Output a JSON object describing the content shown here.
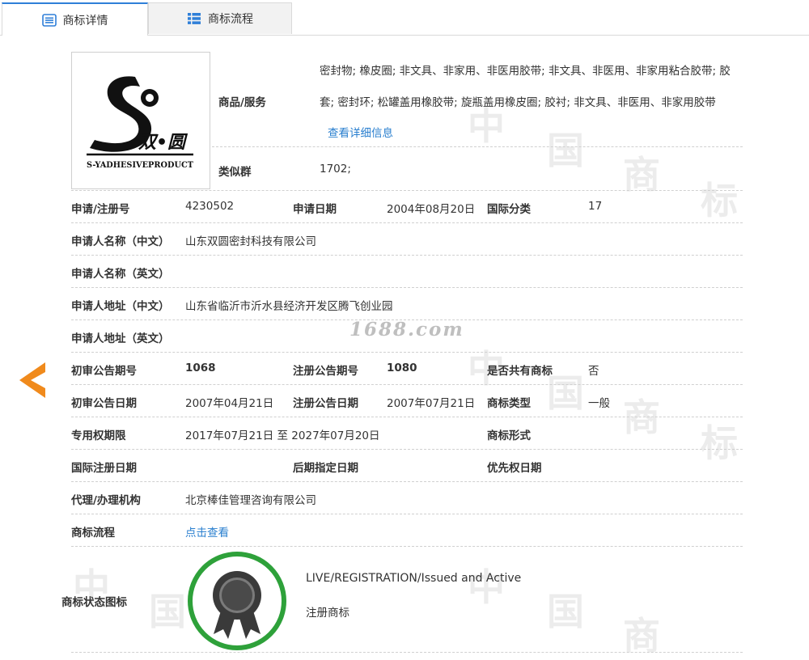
{
  "tabs": {
    "detail": "商标详情",
    "flow": "商标流程"
  },
  "watermark": {
    "site": "1688.com",
    "chars": [
      "中",
      "国",
      "商",
      "标"
    ]
  },
  "logo": {
    "brand_cn": "双•圆",
    "brand_en": "S-YADHESIVEPRODUCT"
  },
  "goods": {
    "label": "商品/服务",
    "line1": "密封物; 橡皮圈; 非文具、非家用、非医用胶带; 非文具、非医用、非家用粘合胶带; 胶",
    "line2": "套; 密封环; 松罐盖用橡胶带; 旋瓶盖用橡皮圈; 胶衬; 非文具、非医用、非家用胶带",
    "more": "查看详细信息"
  },
  "similar_group": {
    "label": "类似群",
    "value": "1702;"
  },
  "fields": {
    "reg_no_label": "申请/注册号",
    "reg_no": "4230502",
    "apply_date_label": "申请日期",
    "apply_date": "2004年08月20日",
    "intl_class_label": "国际分类",
    "intl_class": "17",
    "applicant_cn_label": "申请人名称（中文）",
    "applicant_cn": "山东双圆密封科技有限公司",
    "applicant_en_label": "申请人名称（英文）",
    "applicant_en": "",
    "address_cn_label": "申请人地址（中文）",
    "address_cn": "山东省临沂市沂水县经济开发区腾飞创业园",
    "address_en_label": "申请人地址（英文）",
    "address_en": "",
    "prelim_no_label": "初审公告期号",
    "prelim_no": "1068",
    "reg_notice_no_label": "注册公告期号",
    "reg_notice_no": "1080",
    "shared_label": "是否共有商标",
    "shared": "否",
    "prelim_date_label": "初审公告日期",
    "prelim_date": "2007年04月21日",
    "reg_notice_date_label": "注册公告日期",
    "reg_notice_date": "2007年07月21日",
    "tm_type_label": "商标类型",
    "tm_type": "一般",
    "exclusive_label": "专用权期限",
    "exclusive": "2017年07月21日 至 2027年07月20日",
    "tm_form_label": "商标形式",
    "tm_form": "",
    "intl_reg_date_label": "国际注册日期",
    "intl_reg_date": "",
    "later_date_label": "后期指定日期",
    "later_date": "",
    "priority_date_label": "优先权日期",
    "priority_date": "",
    "agent_label": "代理/办理机构",
    "agent": "北京棒佳管理咨询有限公司",
    "flow_label": "商标流程",
    "flow_link": "点击查看"
  },
  "status": {
    "label": "商标状态图标",
    "en": "LIVE/REGISTRATION/Issued and Active",
    "cn": "注册商标"
  },
  "colors": {
    "accent": "#2a7fcf",
    "status_green": "#2ea13a",
    "arrow_orange": "#f08a1c"
  }
}
